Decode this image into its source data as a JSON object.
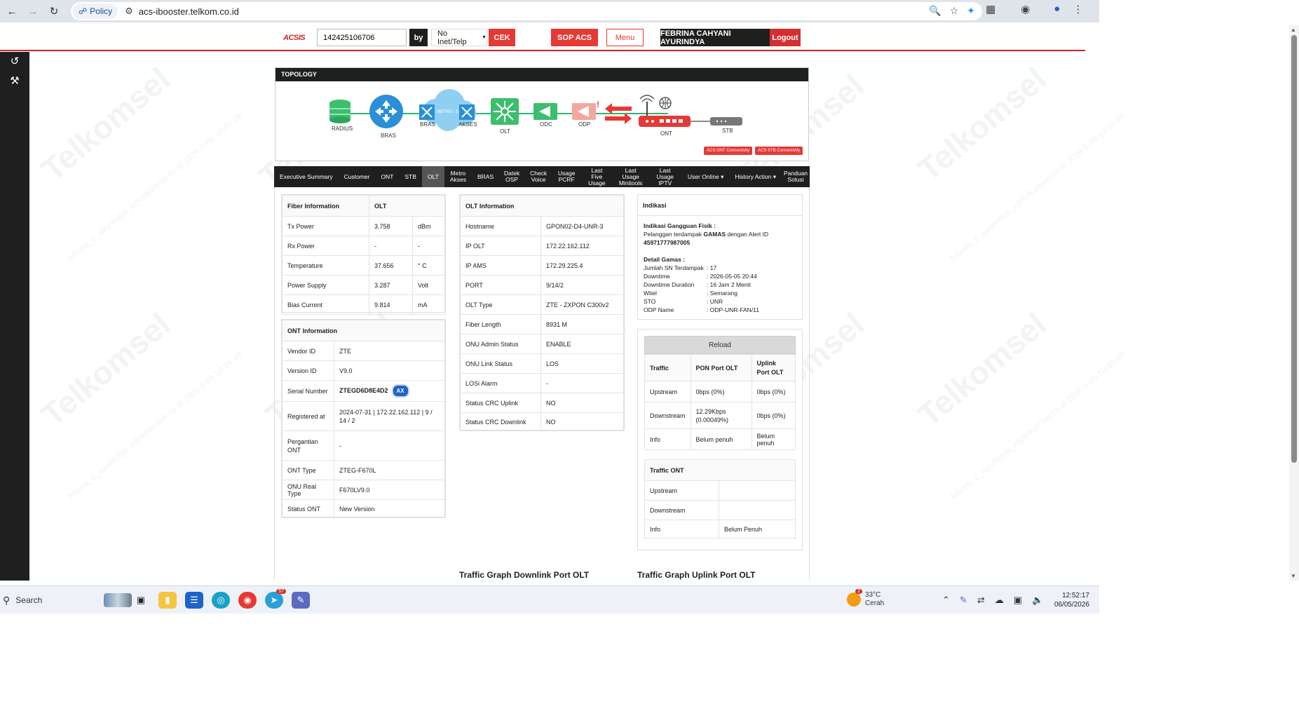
{
  "browser": {
    "policy_label": "Policy",
    "url": "acs-ibooster.telkom.co.id"
  },
  "header": {
    "logo": "ACSIS",
    "search_value": "142425106706",
    "by_label": "by",
    "select_value": "No Inet/Telp",
    "cek_label": "CEK",
    "sop_label": "SOP ACS",
    "menu_label": "Menu",
    "user_name": "FEBRINA CAHYANI AYURINDYA",
    "logout_label": "Logout"
  },
  "topology": {
    "title": "TOPOLOGY",
    "nodes": {
      "radius": "RADIUS",
      "bras": "BRAS",
      "metro": "METRO - E",
      "bras2": "BRAS",
      "akses": "AKSES",
      "olt": "OLT",
      "odc": "ODC",
      "odp": "ODP",
      "ont": "ONT",
      "stb": "STB"
    },
    "badges": [
      "ACS ONT Connectivity",
      "ACS STB Connectivity"
    ]
  },
  "tabs": [
    "Executive Summary",
    "Customer",
    "ONT",
    "STB",
    "OLT",
    "Metro Akses",
    "BRAS",
    "Datek OSP",
    "Check Voice",
    "Usage PCRF",
    "Last Five Usage",
    "Last Usage Minitools",
    "Last Usage IPTV",
    "User Online ▾",
    "History Action ▾",
    "Panduan Solusi"
  ],
  "fiber": {
    "head": [
      "Fiber Information",
      "OLT"
    ],
    "rows": [
      {
        "label": "Tx Power",
        "value": "3.758",
        "unit": "dBm"
      },
      {
        "label": "Rx Power",
        "value": "-",
        "unit": "-"
      },
      {
        "label": "Temperature",
        "value": "37.656",
        "unit": "° C"
      },
      {
        "label": "Power Supply",
        "value": "3.287",
        "unit": "Volt"
      },
      {
        "label": "Bias Current",
        "value": "9.814",
        "unit": "mA"
      }
    ]
  },
  "ont": {
    "head": "ONT Information",
    "rows": [
      {
        "label": "Vendor ID",
        "value": "ZTE"
      },
      {
        "label": "Version ID",
        "value": "V9.0"
      },
      {
        "label": "Serial Number",
        "value": "ZTEGD6D8E4D2",
        "badge": "AX"
      },
      {
        "label": "Registered at",
        "value": "2024-07-31 | 172.22.162.112 | 9 / 14 / 2"
      },
      {
        "label": "Pergantian ONT",
        "value": "-"
      },
      {
        "label": "ONT Type",
        "value": "ZTEG-F670L"
      },
      {
        "label": "ONU Real Type",
        "value": "F670LV9.0"
      },
      {
        "label": "Status ONT",
        "value": "New Version"
      }
    ]
  },
  "olt": {
    "head": "OLT Information",
    "rows": [
      {
        "label": "Hostname",
        "value": "GPON02-D4-UNR-3"
      },
      {
        "label": "IP OLT",
        "value": "172.22.162.112"
      },
      {
        "label": "IP AMS",
        "value": "172.29.225.4"
      },
      {
        "label": "PORT",
        "value": "9/14/2"
      },
      {
        "label": "OLT Type",
        "value": "ZTE - ZXPON C300v2"
      },
      {
        "label": "Fiber Length",
        "value": "8931 M"
      },
      {
        "label": "ONU Admin Status",
        "value": "ENABLE"
      },
      {
        "label": "ONU Link Status",
        "value": "LOS"
      },
      {
        "label": "LOSi Alarm",
        "value": "-"
      },
      {
        "label": "Status CRC Uplink",
        "value": "NO"
      },
      {
        "label": "Status CRC Downlink",
        "value": "NO"
      }
    ]
  },
  "indikasi": {
    "head": "Indikasi",
    "gangguan_title": "Indikasi Gangguan Fisik :",
    "gangguan_line_pre": "Pelanggan terdampak ",
    "gangguan_line_bold": "GAMAS",
    "gangguan_line_post": " dengan Alert ID",
    "alert_id": "45971777987005",
    "detail_title": "Detail Gamas :",
    "details": [
      {
        "key": "Jumlah SN Terdampak",
        "value": ": 17"
      },
      {
        "key": "Downtime",
        "value": ": 2026-05-05 20:44"
      },
      {
        "key": "Downtime Duration",
        "value": ": 16 Jam 2 Menit"
      },
      {
        "key": "Witel",
        "value": ": Semarang"
      },
      {
        "key": "STO",
        "value": ": UNR"
      },
      {
        "key": "ODP Name",
        "value": ": ODP-UNR-FAN/11"
      }
    ]
  },
  "traffic": {
    "reload_label": "Reload",
    "head": [
      "Traffic",
      "PON Port OLT",
      "Uplink Port OLT"
    ],
    "rows": [
      [
        "Upstream",
        "0bps (0%)",
        "0bps (0%)"
      ],
      [
        "Downstream",
        "12.29Kbps (0.00049%)",
        "0bps (0%)"
      ],
      [
        "Info",
        "Belum penuh",
        "Belum penuh"
      ]
    ]
  },
  "traffic_ont": {
    "head": "Traffic ONT",
    "rows": [
      [
        "Upstream",
        ""
      ],
      [
        "Downstream",
        ""
      ],
      [
        "Info",
        "Belum Penuh"
      ]
    ]
  },
  "graphs": {
    "downlink_title": "Traffic Graph Downlink Port OLT",
    "uplink_title": "Traffic Graph Uplink Port OLT"
  },
  "watermark": {
    "text": "Telkomsel",
    "small": "febrina_c_ayurindya_x@telkomsel.co.id 2026-5-06 10:05:49"
  },
  "taskbar": {
    "search_label": "Search",
    "telegram_badge": "57",
    "weather_badge": "2",
    "temp": "33°C",
    "condition": "Cerah",
    "time": "12:52:17",
    "date": "06/05/2026"
  }
}
